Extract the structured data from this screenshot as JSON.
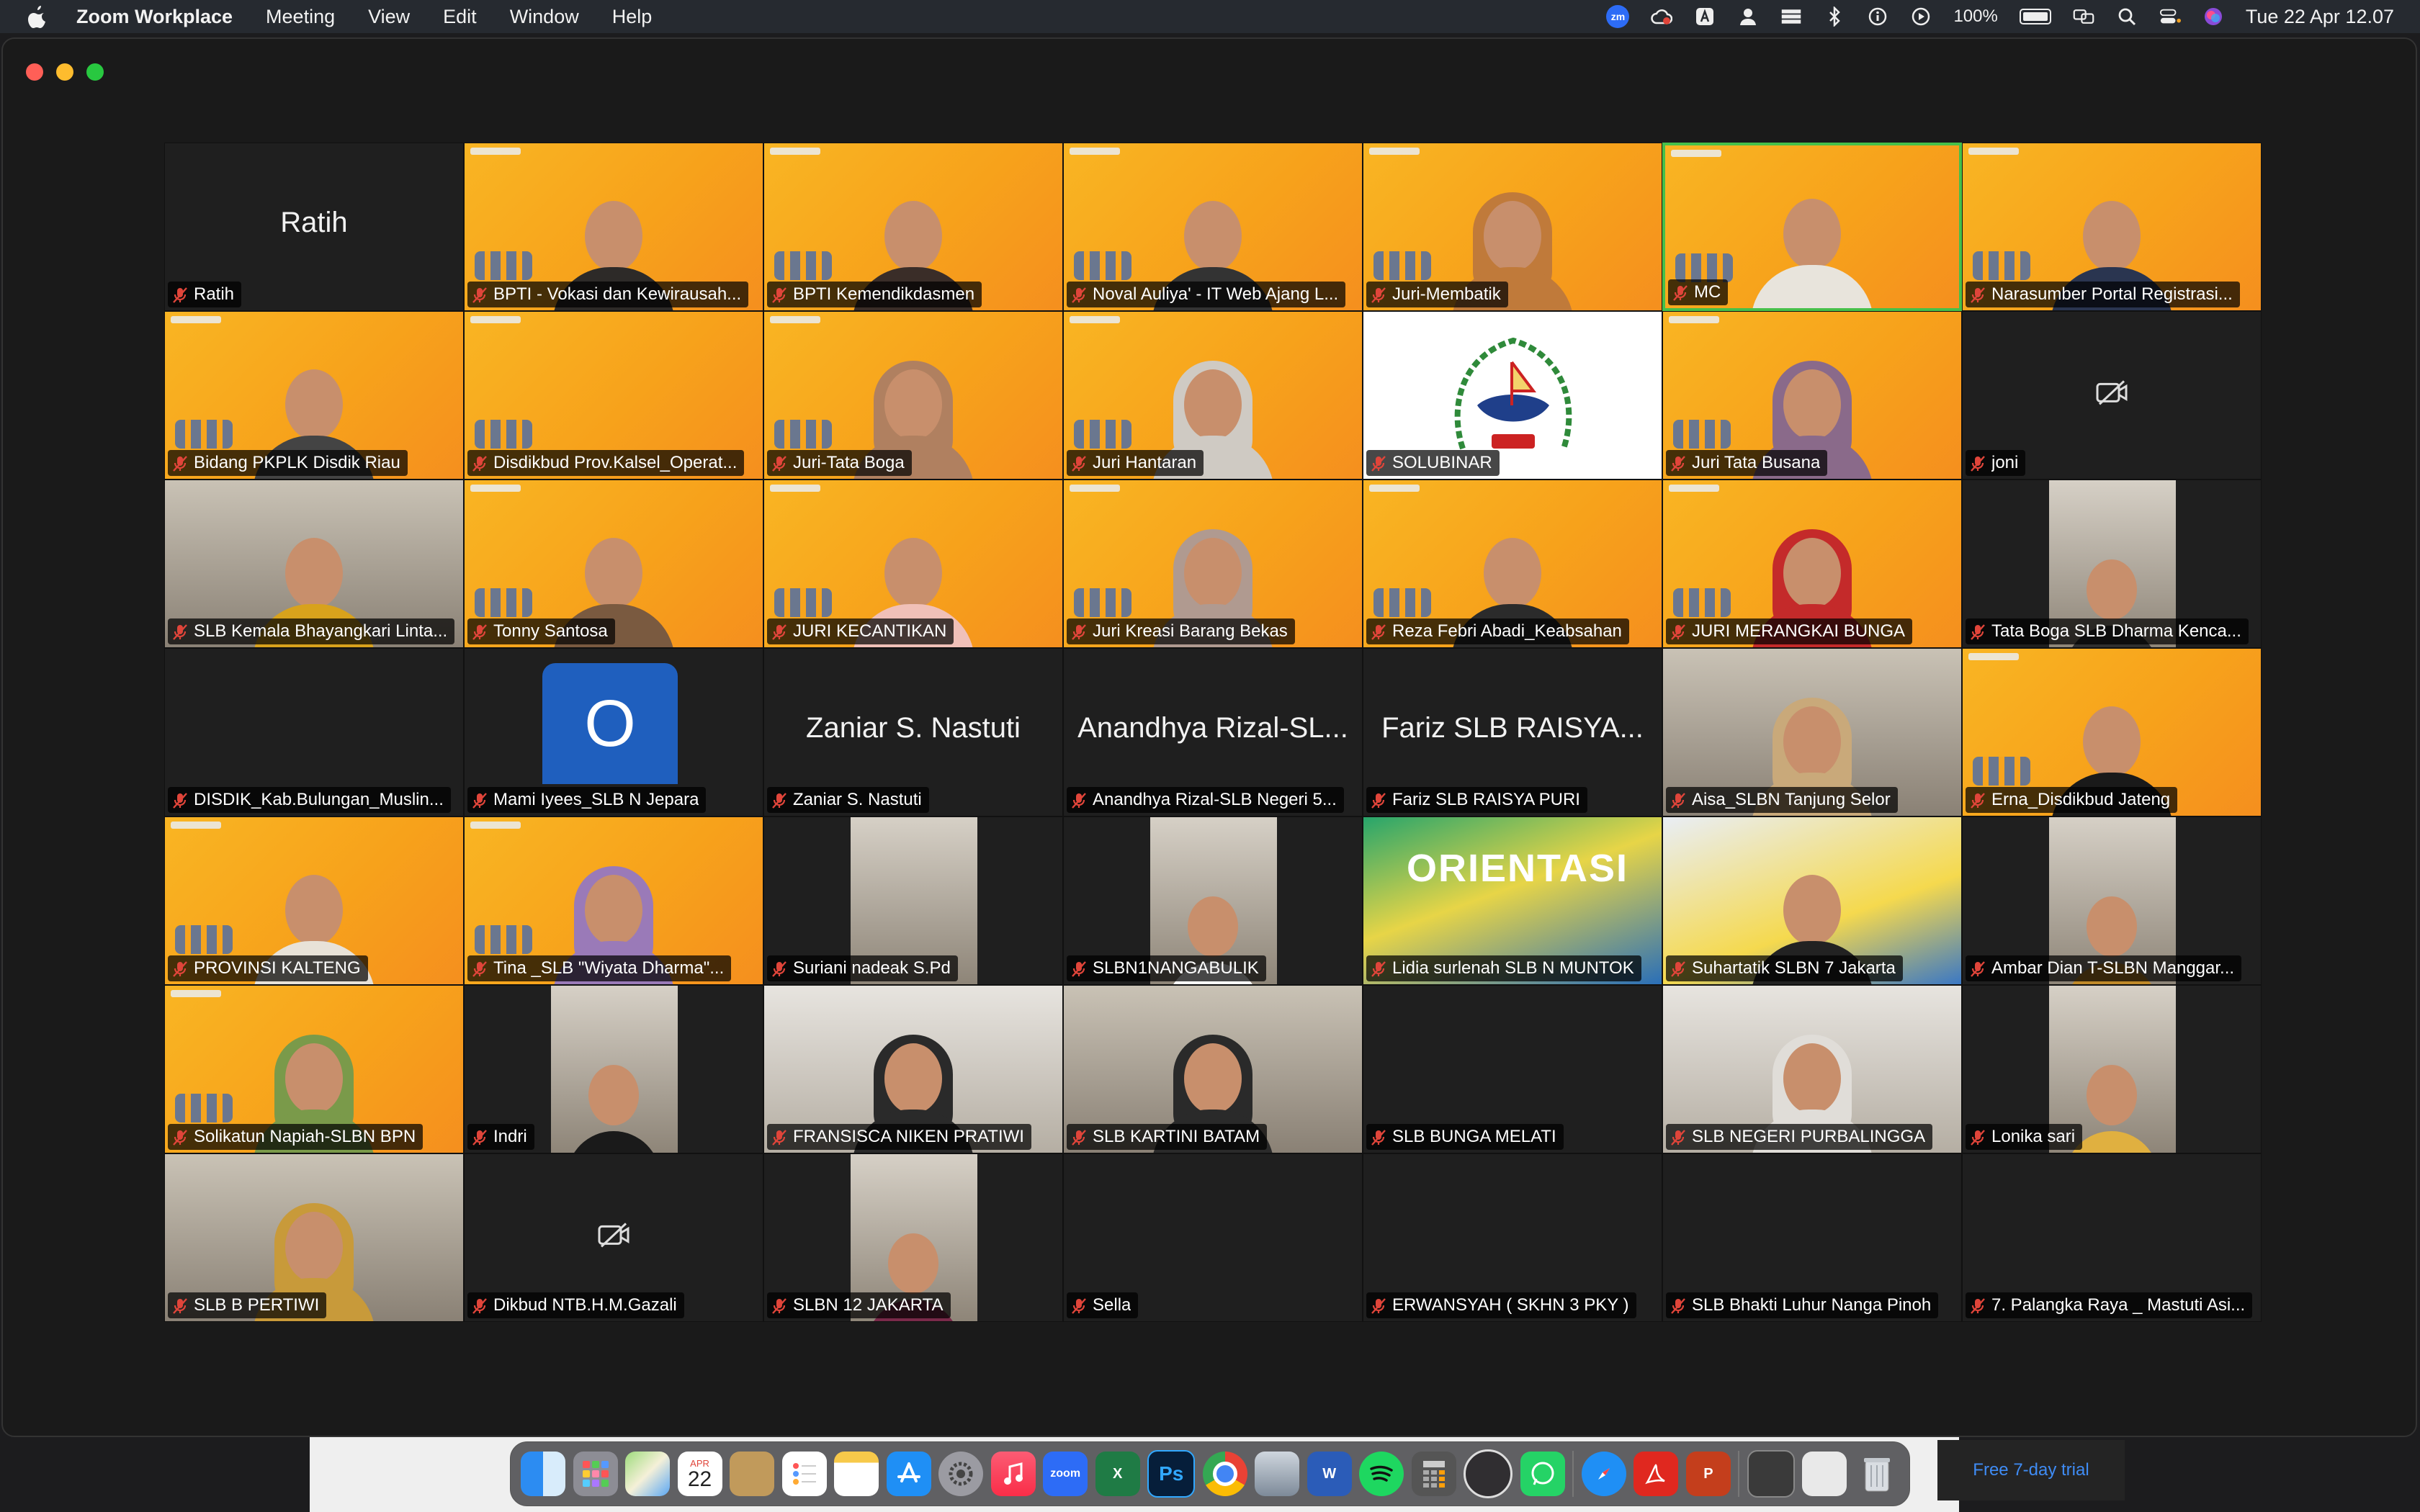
{
  "menubar": {
    "app_name": "Zoom Workplace",
    "items": [
      "Meeting",
      "View",
      "Edit",
      "Window",
      "Help"
    ],
    "battery": "100%",
    "clock": "Tue 22 Apr  12.07"
  },
  "tiles": [
    {
      "name": "Ratih",
      "big_name": "Ratih"
    },
    {
      "name": "BPTI - Vokasi dan Kewirausah..."
    },
    {
      "name": "BPTI Kemendikdasmen"
    },
    {
      "name": "Noval Auliya' - IT Web Ajang L..."
    },
    {
      "name": "Juri-Membatik"
    },
    {
      "name": "MC"
    },
    {
      "name": "Narasumber Portal Registrasi..."
    },
    {
      "name": "Bidang PKPLK Disdik Riau"
    },
    {
      "name": "Disdikbud Prov.Kalsel_Operat..."
    },
    {
      "name": "Juri-Tata Boga"
    },
    {
      "name": "Juri Hantaran"
    },
    {
      "name": "SOLUBINAR"
    },
    {
      "name": "Juri Tata Busana"
    },
    {
      "name": "joni"
    },
    {
      "name": "SLB Kemala Bhayangkari Linta..."
    },
    {
      "name": "Tonny Santosa"
    },
    {
      "name": "JURI KECANTIKAN"
    },
    {
      "name": "Juri Kreasi Barang Bekas"
    },
    {
      "name": "Reza Febri Abadi_Keabsahan"
    },
    {
      "name": "JURI MERANGKAI BUNGA"
    },
    {
      "name": "Tata Boga SLB Dharma Kenca..."
    },
    {
      "name": "DISDIK_Kab.Bulungan_Muslin..."
    },
    {
      "name": "Mami Iyees_SLB N Jepara",
      "avatar_letter": "O"
    },
    {
      "name": "Zaniar S. Nastuti",
      "big_name": "Zaniar S. Nastuti"
    },
    {
      "name": "Anandhya Rizal-SLB Negeri 5...",
      "big_name": "Anandhya Rizal-SL..."
    },
    {
      "name": "Fariz SLB RAISYA PURI",
      "big_name": "Fariz SLB RAISYA..."
    },
    {
      "name": "Aisa_SLBN Tanjung Selor"
    },
    {
      "name": "Erna_Disdikbud Jateng"
    },
    {
      "name": "PROVINSI KALTENG"
    },
    {
      "name": "Tina _SLB \"Wiyata Dharma\"..."
    },
    {
      "name": "Suriani nadeak S.Pd"
    },
    {
      "name": "SLBN1NANGABULIK"
    },
    {
      "name": "Lidia surlenah SLB N MUNTOK",
      "poster_text": "ORIENTASI"
    },
    {
      "name": "Suhartatik SLBN 7 Jakarta"
    },
    {
      "name": "Ambar Dian T-SLBN Manggar..."
    },
    {
      "name": "Solikatun Napiah-SLBN BPN"
    },
    {
      "name": "Indri"
    },
    {
      "name": "FRANSISCA NIKEN PRATIWI"
    },
    {
      "name": "SLB KARTINI BATAM"
    },
    {
      "name": "SLB BUNGA MELATI"
    },
    {
      "name": "SLB NEGERI PURBALINGGA"
    },
    {
      "name": "Lonika sari"
    },
    {
      "name": "SLB B PERTIWI"
    },
    {
      "name": "Dikbud NTB.H.M.Gazali"
    },
    {
      "name": "SLBN 12 JAKARTA"
    },
    {
      "name": "Sella"
    },
    {
      "name": "ERWANSYAH ( SKHN 3 PKY )"
    },
    {
      "name": "SLB Bhakti Luhur Nanga Pinoh"
    },
    {
      "name": "7. Palangka Raya _ Mastuti Asi..."
    }
  ],
  "dock": {
    "calendar_month": "APR",
    "calendar_day": "22",
    "zoom_label": "zoom",
    "ps_label": "Ps"
  },
  "trial_text": "Free 7-day trial",
  "colors": {
    "active_speaker_border": "#46c04a",
    "muted_mic": "#e0453a",
    "banner_orange": "#f7a21b"
  }
}
